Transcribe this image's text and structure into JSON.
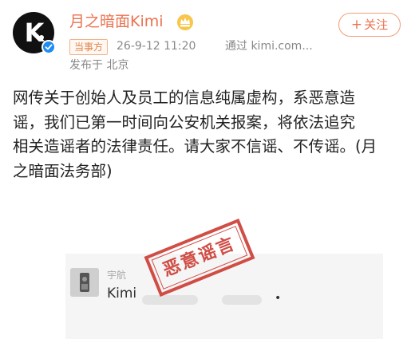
{
  "post": {
    "author": {
      "username": "月之暗面Kimi",
      "avatar_letter": "K",
      "badge_icon": "crown-icon",
      "verified_icon": "verified-check-icon"
    },
    "follow_button": {
      "plus": "+",
      "label": "关注"
    },
    "meta": {
      "tag": "当事方",
      "time": "26-9-12 11:20",
      "source": "通过 kimi.com...",
      "location": "发布于 北京"
    },
    "text_lines": [
      "网传关于创始人及员工的信息纯属虚构，系恶意造",
      "谣，我们已第一时间向公安机关报案，将依法追究",
      "相关造谣者的法律责任。请大家不信谣、不传谣。(月",
      "之暗面法务部)"
    ],
    "embedded_image": {
      "name_label": "宇航",
      "message": "Kimi",
      "stamp_text": "恶意谣言"
    }
  },
  "colors": {
    "accent": "#eb7350",
    "stamp": "#cc3b33",
    "verified": "#1e8cf0"
  }
}
